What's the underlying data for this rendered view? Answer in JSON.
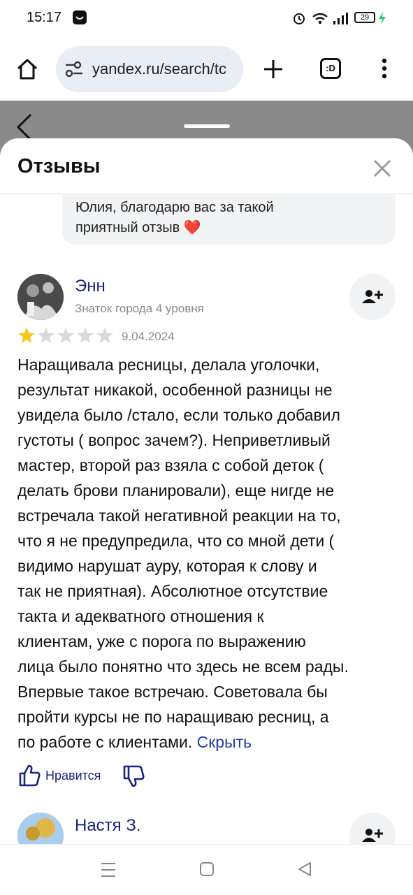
{
  "status_bar": {
    "time": "15:17",
    "battery": "29"
  },
  "browser": {
    "url": "yandex.ru/search/tc"
  },
  "sheet": {
    "title": "Отзывы",
    "reply": {
      "line1": "Юлия, благодарю вас за такой",
      "line2": "приятный отзыв ❤️"
    },
    "reviews": [
      {
        "name": "Энн",
        "level": "Знаток города 4 уровня",
        "rating": 1,
        "max_rating": 5,
        "date": "9.04.2024",
        "text_lines": [
          "Наращивала ресницы, делала уголочки,",
          "результат никакой, особенной разницы не",
          "увидела было /стало, если только добавил",
          "густоты ( вопрос зачем?). Неприветливый",
          "мастер, второй раз взяла с собой деток (",
          "делать брови планировали), еще нигде не",
          "встречала такой негативной реакции на то,",
          "что я не предупредила, что со мной дети (",
          "видимо нарушат ауру, которая к слову и",
          "так не приятная). Абсолютное отсутствие",
          "такта и адекватного отношения к",
          "клиентам, уже с порога по выражению",
          "лица было понятно что здесь не всем рады.",
          "Впервые такое встречаю. Советовала бы",
          "пройти курсы не по наращиваю ресниц, а"
        ],
        "last_line": "по работе с клиентами.",
        "hide_label": "Скрыть",
        "like_label": "Нравится"
      },
      {
        "name": "Настя З."
      }
    ]
  },
  "colors": {
    "accent": "#1a237e",
    "star_on": "#f5c518",
    "star_off": "#d9d9d9",
    "dim": "#8a8a8a"
  }
}
